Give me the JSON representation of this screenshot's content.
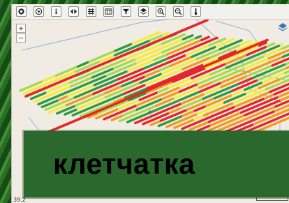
{
  "toolbar": {
    "buttons": [
      {
        "name": "pan",
        "icon": "pan-arrows-icon"
      },
      {
        "name": "target",
        "icon": "target-icon"
      },
      {
        "name": "info",
        "icon": "info-icon"
      },
      {
        "name": "nav",
        "icon": "arrows-lr-icon"
      },
      {
        "name": "grid",
        "icon": "grid-icon"
      },
      {
        "name": "table",
        "icon": "table-icon"
      },
      {
        "name": "filter",
        "icon": "filter-icon"
      },
      {
        "name": "layers",
        "icon": "layers-icon"
      },
      {
        "name": "zoom-in",
        "icon": "magnifier-plus-icon"
      },
      {
        "name": "zoom-out",
        "icon": "magnifier-minus-icon"
      },
      {
        "name": "thermometer",
        "icon": "thermometer-icon"
      }
    ]
  },
  "map_controls": {
    "zoom_in_label": "+",
    "zoom_out_label": "−"
  },
  "status": {
    "coordinates": "39.2"
  },
  "banner": {
    "text": "клетчатка"
  },
  "colors": {
    "red": "#e3262a",
    "orange": "#f29a1b",
    "yellow": "#f5ec3a",
    "light_green": "#a9d94a",
    "green": "#2e9b3e",
    "banner_bg": "#2b682e",
    "map_bg": "#f1ece3",
    "field_outline": "#8fb1d9"
  }
}
